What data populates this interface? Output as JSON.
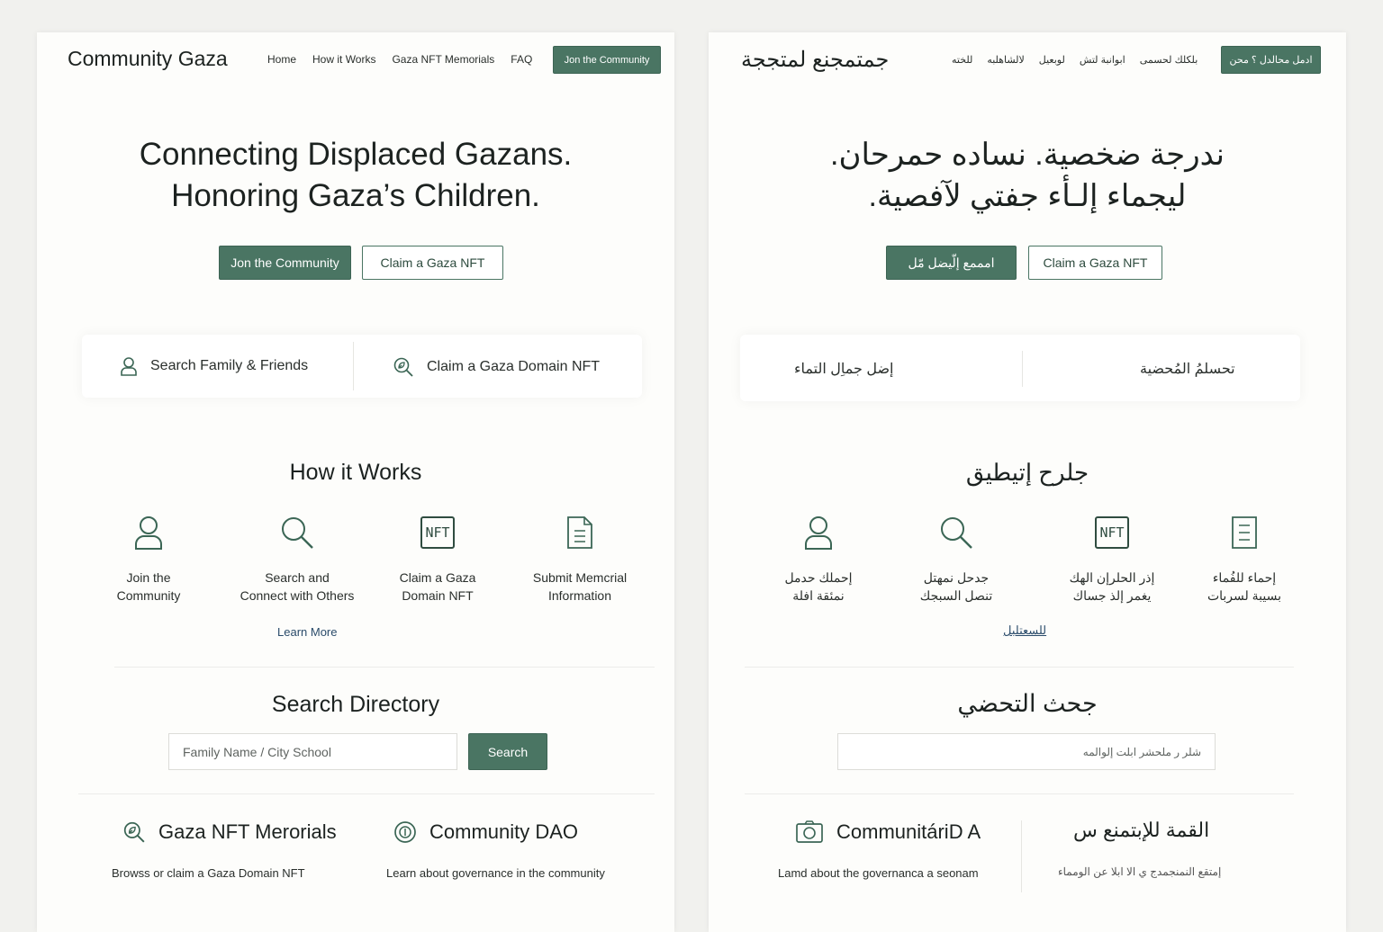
{
  "colors": {
    "accent": "#4a7563",
    "page_bg": "#f1f1ee",
    "panel_bg": "#fdfdfb",
    "link": "#2a4b6a"
  },
  "en": {
    "logo": "Community Gaza",
    "nav": [
      "Home",
      "How it Works",
      "Gaza NFT Memorials",
      "FAQ"
    ],
    "nav_cta": "Jon the Community",
    "hero_line1": "Connecting Displaced Gazans.",
    "hero_line2": "Honoring Gaza’s Children.",
    "hero_primary": "Jon the Community",
    "hero_secondary": "Claim a Gaza NFT",
    "quick": [
      {
        "label": "Search Family & Friends",
        "icon": "person-icon"
      },
      {
        "label": "Claim a Gaza Domain NFT",
        "icon": "magnifier-leaf-icon"
      }
    ],
    "how_title": "How it Works",
    "steps": [
      {
        "line1": "Join the",
        "line2": "Community",
        "icon": "person-icon"
      },
      {
        "line1": "Search and",
        "line2": "Connect with Others",
        "icon": "search-icon"
      },
      {
        "line1": "Claim a Gaza",
        "line2": "Domain NFT",
        "icon": "nft-icon",
        "icon_text": "NFT"
      },
      {
        "line1": "Submit Memcrial",
        "line2": "Information",
        "icon": "document-icon"
      }
    ],
    "learn_more": "Learn More",
    "search_title": "Search Directory",
    "search_placeholder": "Family Name / City School",
    "search_button": "Search",
    "features": [
      {
        "title": "Gaza NFT Merorials",
        "desc": "Browss or claim a Gaza Domain NFT",
        "icon": "magnifier-leaf-icon"
      },
      {
        "title": "Community DAO",
        "desc": "Learn about governance in the community",
        "icon": "coin-icon"
      }
    ]
  },
  "ar": {
    "logo": "جمتمجنع لمتججة",
    "nav": [
      "للخته",
      "لالشاهلبه",
      "لوبعيل",
      "ابوانبة لتش",
      "بلكلك لحسمى"
    ],
    "nav_cta": "ادمل محالدل ؟ محن",
    "hero_line1": "ندرجة ضخصية. نساده حمرحان.",
    "hero_line2": "ليجماء إلـأء جفتي لآفصية.",
    "hero_primary": "امممع إلّيضل مّل",
    "hero_secondary": "Claim a Gaza NFT",
    "quick": [
      {
        "label": "إضل جماِل التماء"
      },
      {
        "label": "تحسلمُ المُحضية"
      }
    ],
    "how_title": "جلرح إتيطيق",
    "steps": [
      {
        "line1": "إحملك حدمل",
        "line2": "نمئقة افلة",
        "icon": "person-icon"
      },
      {
        "line1": "جدحل نمهتل",
        "line2": "تنصل السبجك",
        "icon": "search-icon"
      },
      {
        "line1": "إذر الحلرإن الهك",
        "line2": "يغمر إلذ جساك",
        "icon": "nft-icon",
        "icon_text": "NFT"
      },
      {
        "line1": "إحماء للفُماء",
        "line2": "بسيبة لسربات",
        "icon": "document-icon"
      }
    ],
    "learn_more": "للسعتلبل",
    "search_title": "جحث التحضي",
    "search_placeholder": "شلر ر ملحشر ابلت إلوالمه",
    "features": [
      {
        "title": "CommunitáriD A",
        "desc": "Lamd about the governanca  a seonam",
        "icon": "camera-icon"
      },
      {
        "title": "القمة للإبتمنع س",
        "desc": "إمتقع النمنجمدج ي الا ابلا عن الومماء"
      }
    ]
  }
}
